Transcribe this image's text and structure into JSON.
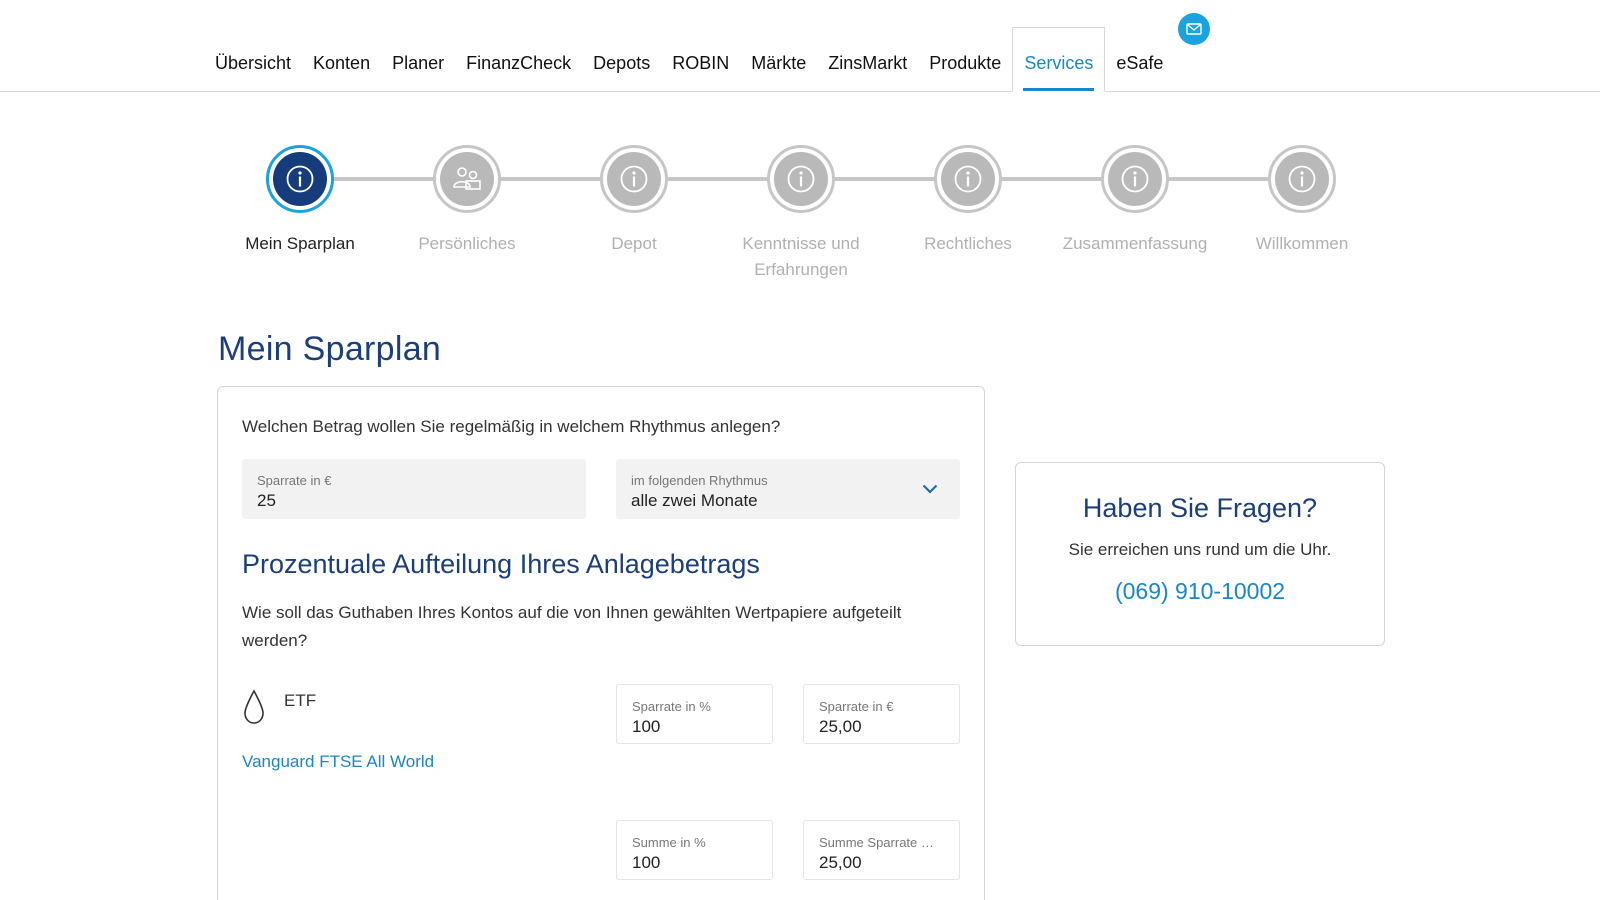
{
  "nav": {
    "items": [
      {
        "label": "Übersicht",
        "active": false
      },
      {
        "label": "Konten",
        "active": false
      },
      {
        "label": "Planer",
        "active": false
      },
      {
        "label": "FinanzCheck",
        "active": false
      },
      {
        "label": "Depots",
        "active": false
      },
      {
        "label": "ROBIN",
        "active": false
      },
      {
        "label": "Märkte",
        "active": false
      },
      {
        "label": "ZinsMarkt",
        "active": false
      },
      {
        "label": "Produkte",
        "active": false
      },
      {
        "label": "Services",
        "active": true
      },
      {
        "label": "eSafe",
        "active": false
      }
    ],
    "mail_icon": "envelope-icon"
  },
  "stepper": {
    "steps": [
      {
        "label": "Mein Sparplan",
        "icon": "info-icon",
        "active": true
      },
      {
        "label": "Persönliches",
        "icon": "persons-icon",
        "active": false
      },
      {
        "label": "Depot",
        "icon": "info-icon",
        "active": false
      },
      {
        "label": "Kenntnisse und Erfahrungen",
        "icon": "info-icon",
        "active": false
      },
      {
        "label": "Rechtliches",
        "icon": "info-icon",
        "active": false
      },
      {
        "label": "Zusammenfassung",
        "icon": "info-icon",
        "active": false
      },
      {
        "label": "Willkommen",
        "icon": "info-icon",
        "active": false
      }
    ]
  },
  "main": {
    "title": "Mein Sparplan",
    "question": "Welchen Betrag wollen Sie regelmäßig in welchem Rhythmus anlegen?",
    "rate_field": {
      "label": "Sparrate in €",
      "value": "25"
    },
    "rhythm_field": {
      "label": "im folgenden Rhythmus",
      "value": "alle zwei Monate"
    },
    "allocation_title": "Prozentuale Aufteilung Ihres Anlagebetrags",
    "allocation_text": "Wie soll das Guthaben Ihres Kontos auf die von Ihnen gewählten Wertpapiere aufgeteilt werden?",
    "etf": {
      "type_label": "ETF",
      "name": "Vanguard FTSE All World",
      "percent_field": {
        "label": "Sparrate in %",
        "value": "100"
      },
      "amount_field": {
        "label": "Sparrate in €",
        "value": "25,00"
      }
    },
    "sum": {
      "percent_field": {
        "label": "Summe in %",
        "value": "100"
      },
      "amount_field": {
        "label": "Summe Sparrate …",
        "value": "25,00"
      }
    }
  },
  "side": {
    "title": "Haben Sie Fragen?",
    "text": "Sie erreichen uns rund um die Uhr.",
    "phone": "(069) 910-10002"
  },
  "colors": {
    "brand_dark": "#1c3f7a",
    "accent": "#1a86c7",
    "badge": "#1aa3df",
    "inactive": "#b9b9b9"
  }
}
